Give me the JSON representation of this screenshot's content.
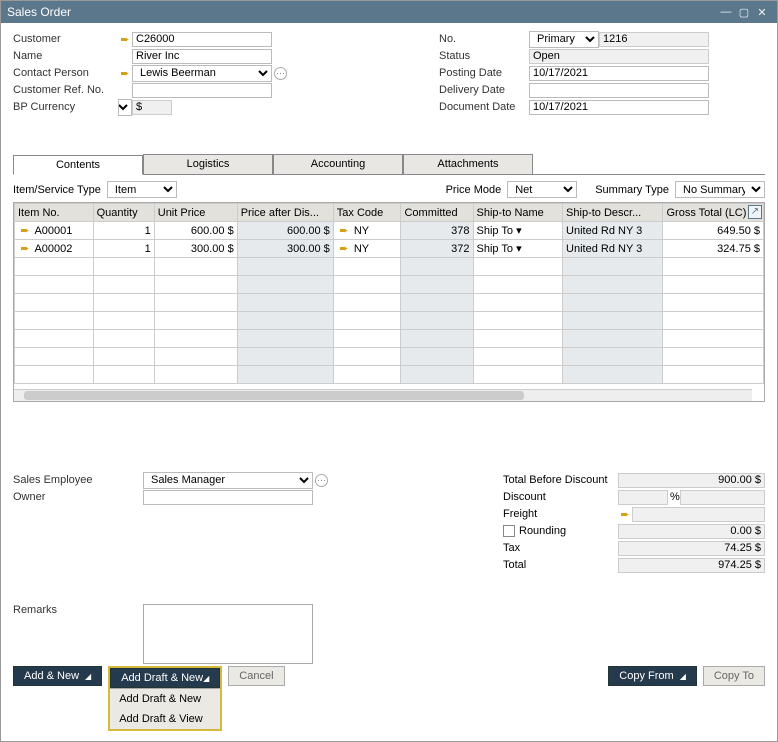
{
  "window": {
    "title": "Sales Order"
  },
  "header": {
    "left": {
      "customer_label": "Customer",
      "customer": "C26000",
      "name_label": "Name",
      "name": "River Inc",
      "contact_label": "Contact Person",
      "contact": "Lewis Beerman",
      "custref_label": "Customer Ref. No.",
      "custref": "",
      "bpcur_label": "BP Currency",
      "bpcur_sym": "$"
    },
    "right": {
      "no_label": "No.",
      "no_series": "Primary",
      "no_value": "1216",
      "status_label": "Status",
      "status": "Open",
      "posting_label": "Posting Date",
      "posting": "10/17/2021",
      "delivery_label": "Delivery Date",
      "delivery": "",
      "docdate_label": "Document Date",
      "docdate": "10/17/2021"
    }
  },
  "tabs": {
    "contents": "Contents",
    "logistics": "Logistics",
    "accounting": "Accounting",
    "attachments": "Attachments"
  },
  "subheader": {
    "itemtype_label": "Item/Service Type",
    "itemtype": "Item",
    "pricemode_label": "Price Mode",
    "pricemode": "Net",
    "summarytype_label": "Summary Type",
    "summarytype": "No Summary"
  },
  "grid": {
    "cols": [
      "Item No.",
      "Quantity",
      "Unit Price",
      "Price after Dis...",
      "Tax Code",
      "Committed",
      "Ship-to Name",
      "Ship-to Descr...",
      "Gross Total (LC)"
    ],
    "rows": [
      {
        "item": "A00001",
        "qty": "1",
        "unit": "600.00 $",
        "pad": "600.00 $",
        "tax": "NY",
        "committed": "378",
        "shipname": "Ship To",
        "shipdesc": "United Rd  NY  3",
        "gross": "649.50 $"
      },
      {
        "item": "A00002",
        "qty": "1",
        "unit": "300.00 $",
        "pad": "300.00 $",
        "tax": "NY",
        "committed": "372",
        "shipname": "Ship To",
        "shipdesc": "United Rd  NY  3",
        "gross": "324.75 $"
      }
    ]
  },
  "lowerleft": {
    "salesemp_label": "Sales Employee",
    "salesemp": "Sales Manager",
    "owner_label": "Owner",
    "owner": ""
  },
  "totals": {
    "tbd_label": "Total Before Discount",
    "tbd": "900.00 $",
    "discount_label": "Discount",
    "pct": "%",
    "freight_label": "Freight",
    "rounding_label": "Rounding",
    "rounding": "0.00 $",
    "tax_label": "Tax",
    "tax": "74.25 $",
    "total_label": "Total",
    "total": "974.25 $"
  },
  "remarks_label": "Remarks",
  "buttons": {
    "add_new": "Add & New",
    "add_draft_new": "Add Draft & New",
    "dd1": "Add Draft & New",
    "dd2": "Add Draft & View",
    "cancel": "Cancel",
    "copy_from": "Copy From",
    "copy_to": "Copy To"
  }
}
